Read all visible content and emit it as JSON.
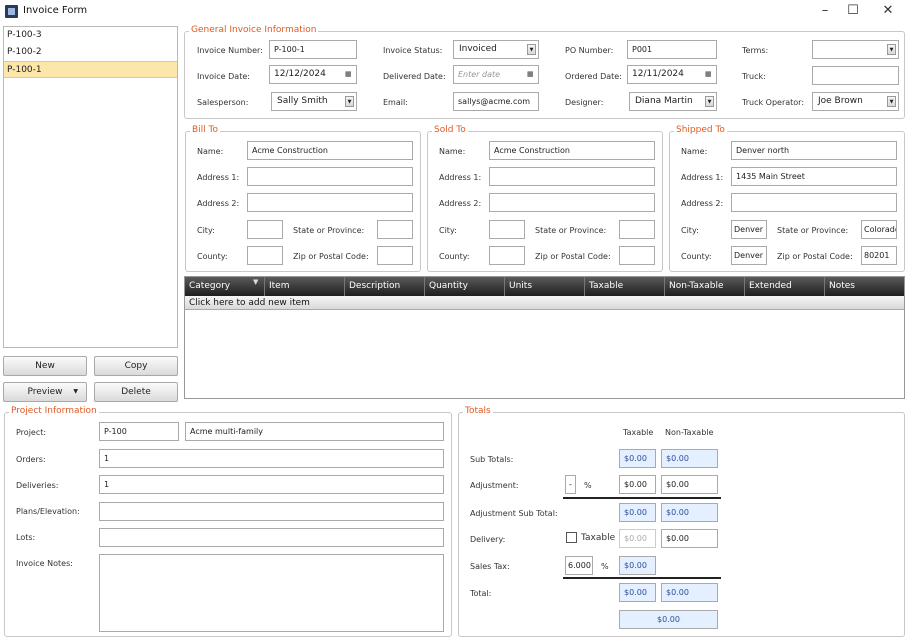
{
  "window": {
    "title": "Invoice Form",
    "minimize": "–",
    "maximize": "☐",
    "close": "✕"
  },
  "invoice_list": {
    "items": [
      "P-100-3",
      "P-100-2",
      "P-100-1"
    ],
    "selected": "P-100-1"
  },
  "buttons": {
    "new": "New",
    "copy": "Copy",
    "preview": "Preview",
    "delete": "Delete"
  },
  "general": {
    "legend": "General Invoice Information",
    "invoice_number_label": "Invoice Number:",
    "invoice_number": "P-100-1",
    "invoice_status_label": "Invoice Status:",
    "invoice_status": "Invoiced",
    "po_number_label": "PO Number:",
    "po_number": "P001",
    "terms_label": "Terms:",
    "terms": "",
    "invoice_date_label": "Invoice Date:",
    "invoice_date": "12/12/2024",
    "delivered_date_label": "Delivered Date:",
    "delivered_date_placeholder": "Enter date",
    "ordered_date_label": "Ordered Date:",
    "ordered_date": "12/11/2024",
    "truck_label": "Truck:",
    "truck": "",
    "salesperson_label": "Salesperson:",
    "salesperson": "Sally Smith",
    "email_label": "Email:",
    "email": "sallys@acme.com",
    "designer_label": "Designer:",
    "designer": "Diana Martin",
    "truck_operator_label": "Truck Operator:",
    "truck_operator": "Joe Brown"
  },
  "bill_to": {
    "legend": "Bill To",
    "name_label": "Name:",
    "name": "Acme Construction",
    "address1_label": "Address 1:",
    "address1": "",
    "address2_label": "Address 2:",
    "address2": "",
    "city_label": "City:",
    "city": "",
    "state_label": "State or Province:",
    "state": "",
    "county_label": "County:",
    "county": "",
    "zip_label": "Zip or Postal Code:",
    "zip": ""
  },
  "sold_to": {
    "legend": "Sold To",
    "name_label": "Name:",
    "name": "Acme Construction",
    "address1_label": "Address 1:",
    "address1": "",
    "address2_label": "Address 2:",
    "address2": "",
    "city_label": "City:",
    "city": "",
    "state_label": "State or Province:",
    "state": "",
    "county_label": "County:",
    "county": "",
    "zip_label": "Zip or Postal Code:",
    "zip": ""
  },
  "shipped_to": {
    "legend": "Shipped To",
    "name_label": "Name:",
    "name": "Denver north",
    "address1_label": "Address 1:",
    "address1": "1435 Main Street",
    "address2_label": "Address 2:",
    "address2": "",
    "city_label": "City:",
    "city": "Denver",
    "state_label": "State or Province:",
    "state": "Colorado",
    "county_label": "County:",
    "county": "Denver",
    "zip_label": "Zip or Postal Code:",
    "zip": "80201"
  },
  "grid": {
    "columns": [
      "Category",
      "Item",
      "Description",
      "Quantity",
      "Units",
      "Taxable",
      "Non-Taxable",
      "Extended",
      "Notes"
    ],
    "add_row": "Click here to add new item"
  },
  "project": {
    "legend": "Project Information",
    "project_label": "Project:",
    "project_id": "P-100",
    "project_name": "Acme multi-family",
    "orders_label": "Orders:",
    "orders": "1",
    "deliveries_label": "Deliveries:",
    "deliveries": "1",
    "plans_label": "Plans/Elevation:",
    "plans": "",
    "lots_label": "Lots:",
    "lots": "",
    "notes_label": "Invoice Notes:",
    "notes": ""
  },
  "totals": {
    "legend": "Totals",
    "taxable_header": "Taxable",
    "nontaxable_header": "Non-Taxable",
    "subtotals_label": "Sub Totals:",
    "subtotal_taxable": "$0.00",
    "subtotal_nontaxable": "$0.00",
    "adjustment_label": "Adjustment:",
    "adjustment_sign": "-",
    "percent_sign": "%",
    "adjustment_taxable": "$0.00",
    "adjustment_nontaxable": "$0.00",
    "adj_subtotal_label": "Adjustment Sub Total:",
    "adj_subtotal_taxable": "$0.00",
    "adj_subtotal_nontaxable": "$0.00",
    "delivery_label": "Delivery:",
    "delivery_taxable_label": "Taxable",
    "delivery_taxable": "$0.00",
    "delivery_nontaxable": "$0.00",
    "sales_tax_label": "Sales Tax:",
    "sales_tax_rate": "6.000",
    "sales_tax_percent": "%",
    "sales_tax_value": "$0.00",
    "total_label": "Total:",
    "total_taxable": "$0.00",
    "total_nontaxable": "$0.00",
    "grand_total": "$0.00"
  }
}
